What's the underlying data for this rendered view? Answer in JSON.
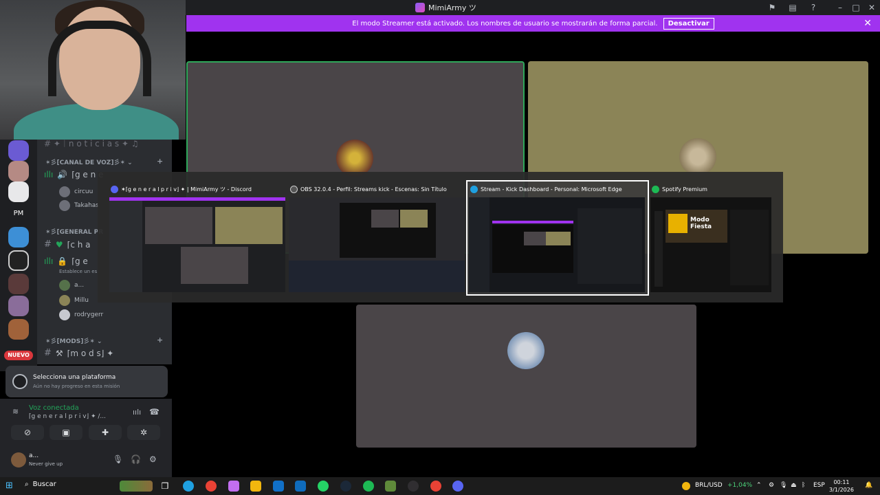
{
  "window": {
    "title": "MimiArmy ツ"
  },
  "banner": {
    "message": "El modo Streamer está activado. Los nombres de usuario se mostrarán de forma parcial.",
    "button_label": "Desactivar"
  },
  "rail": {
    "pm_label": "PM",
    "nuevo_label": "NUEVO"
  },
  "channels": {
    "top_channel": "#  ✦︱n o t i c i a s ✦ ♫",
    "categories": [
      {
        "label": "✶彡[CANAL DE VOZ]彡✶ ⌄"
      },
      {
        "label": "✶彡[GENERAL PR"
      },
      {
        "label": "✶彡[MODS]彡✶ ⌄"
      }
    ],
    "voice_channel_1": "⌈g e n e",
    "voice_users_1": [
      "circuu",
      "Takahas"
    ],
    "text_channel_cha": "⌈c h a",
    "voice_channel_2": "⌈g e",
    "voice_channel_2_status": "Establece un es",
    "voice_users_2": [
      "a...",
      "Millu",
      "rodrygerr"
    ],
    "mods_channel": "⌈m o d s⌋ ✦"
  },
  "quest": {
    "title": "Selecciona una plataforma",
    "subtitle": "Aún no hay progreso en esta misión"
  },
  "voice": {
    "status": "Voz conectada",
    "channel": "⌈g e n e r a l p r i v⌋ ✦ /..."
  },
  "user": {
    "name": "a...",
    "status": "Never give up"
  },
  "switcher": {
    "windows": [
      {
        "title": "✶⌈g e n e r a l p r i v⌋ ✦ | MimiArmy ツ - Discord",
        "color": "#5865f2"
      },
      {
        "title": "OBS 32.0.4 - Perfil: Streams kick - Escenas: Sin Título",
        "color": "#3a3a3a"
      },
      {
        "title": "Stream - Kick Dashboard - Personal: Microsoft Edge",
        "color": "#1fa0e0"
      },
      {
        "title": "Spotify Premium",
        "color": "#1db954"
      }
    ],
    "spotify_big_text": "Modo Fiesta"
  },
  "taskbar": {
    "search_label": "Buscar",
    "currency": "BRL/USD",
    "currency_change": "+1,04%",
    "lang": "ESP",
    "time": "00:11",
    "date": "3/1/2026"
  },
  "colors": {
    "banner": "#a033ef",
    "accent_green": "#23a55a",
    "tile_dark": "#4a4548",
    "tile_olive": "#8b8457"
  }
}
